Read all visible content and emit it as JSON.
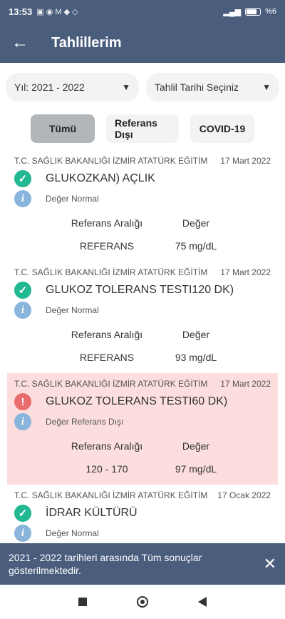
{
  "statusbar": {
    "time": "13:53",
    "battery": "%6"
  },
  "appbar": {
    "title": "Tahlillerim"
  },
  "filters": {
    "year": "Yıl: 2021 - 2022",
    "date": "Tahlil Tarihi Seçiniz"
  },
  "tabs": [
    {
      "label": "Tümü",
      "active": true
    },
    {
      "label": "Referans Dışı",
      "active": false
    },
    {
      "label": "COVID-19",
      "active": false
    }
  ],
  "labels": {
    "ref_range": "Referans Aralığı",
    "value": "Değer"
  },
  "results": [
    {
      "institution": "T.C. SAĞLIK BAKANLIĞI İZMİR ATATÜRK EĞİTİM",
      "date": "17 Mart 2022",
      "name": "GLUKOZKAN) AÇLIK",
      "status": "Değer Normal",
      "ref": "REFERANS",
      "value": "75 mg/dL",
      "alert": false
    },
    {
      "institution": "T.C. SAĞLIK BAKANLIĞI İZMİR ATATÜRK EĞİTİM",
      "date": "17 Mart 2022",
      "name": "GLUKOZ TOLERANS TESTI120 DK)",
      "status": "Değer Normal",
      "ref": "REFERANS",
      "value": "93 mg/dL",
      "alert": false
    },
    {
      "institution": "T.C. SAĞLIK BAKANLIĞI İZMİR ATATÜRK EĞİTİM",
      "date": "17 Mart 2022",
      "name": "GLUKOZ TOLERANS TESTI60 DK)",
      "status": "Değer Referans Dışı",
      "ref": "120 - 170",
      "value": "97 mg/dL",
      "alert": true
    },
    {
      "institution": "T.C. SAĞLIK BAKANLIĞI İZMİR ATATÜRK EĞİTİM",
      "date": "17 Ocak 2022",
      "name": "İDRAR KÜLTÜRÜ",
      "status": "Değer Normal",
      "alert": false
    }
  ],
  "snackbar": {
    "message": "2021 - 2022 tarihleri arasında Tüm sonuçlar gösterilmektedir."
  }
}
